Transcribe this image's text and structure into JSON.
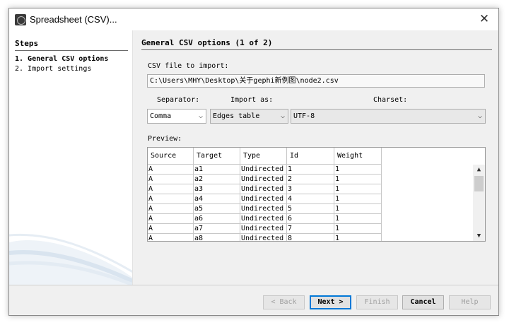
{
  "window": {
    "title": "Spreadsheet (CSV)..."
  },
  "steps": {
    "title": "Steps",
    "items": [
      {
        "label": "1.  General CSV options"
      },
      {
        "label": "2.  Import settings"
      }
    ]
  },
  "panel": {
    "title": "General CSV options (1 of 2)",
    "file_label": "CSV file to import:",
    "file_path": "C:\\Users\\MHY\\Desktop\\关于gephi新例图\\node2.csv",
    "separator_label": "Separator:",
    "import_as_label": "Import as:",
    "charset_label": "Charset:",
    "separator_value": "Comma",
    "import_as_value": "Edges table",
    "charset_value": "UTF-8",
    "preview_label": "Preview:"
  },
  "preview": {
    "columns": [
      "Source",
      "Target",
      "Type",
      "Id",
      "Weight"
    ],
    "rows": [
      [
        "A",
        "a1",
        "Undirected",
        "1",
        "1"
      ],
      [
        "A",
        "a2",
        "Undirected",
        "2",
        "1"
      ],
      [
        "A",
        "a3",
        "Undirected",
        "3",
        "1"
      ],
      [
        "A",
        "a4",
        "Undirected",
        "4",
        "1"
      ],
      [
        "A",
        "a5",
        "Undirected",
        "5",
        "1"
      ],
      [
        "A",
        "a6",
        "Undirected",
        "6",
        "1"
      ],
      [
        "A",
        "a7",
        "Undirected",
        "7",
        "1"
      ],
      [
        "A",
        "a8",
        "Undirected",
        "8",
        "1"
      ]
    ]
  },
  "buttons": {
    "back": "< Back",
    "next": "Next >",
    "finish": "Finish",
    "cancel": "Cancel",
    "help": "Help"
  },
  "icons": {
    "close": "close-icon",
    "app": "gephi-app-icon",
    "dropdown": "chevron-down-icon"
  }
}
